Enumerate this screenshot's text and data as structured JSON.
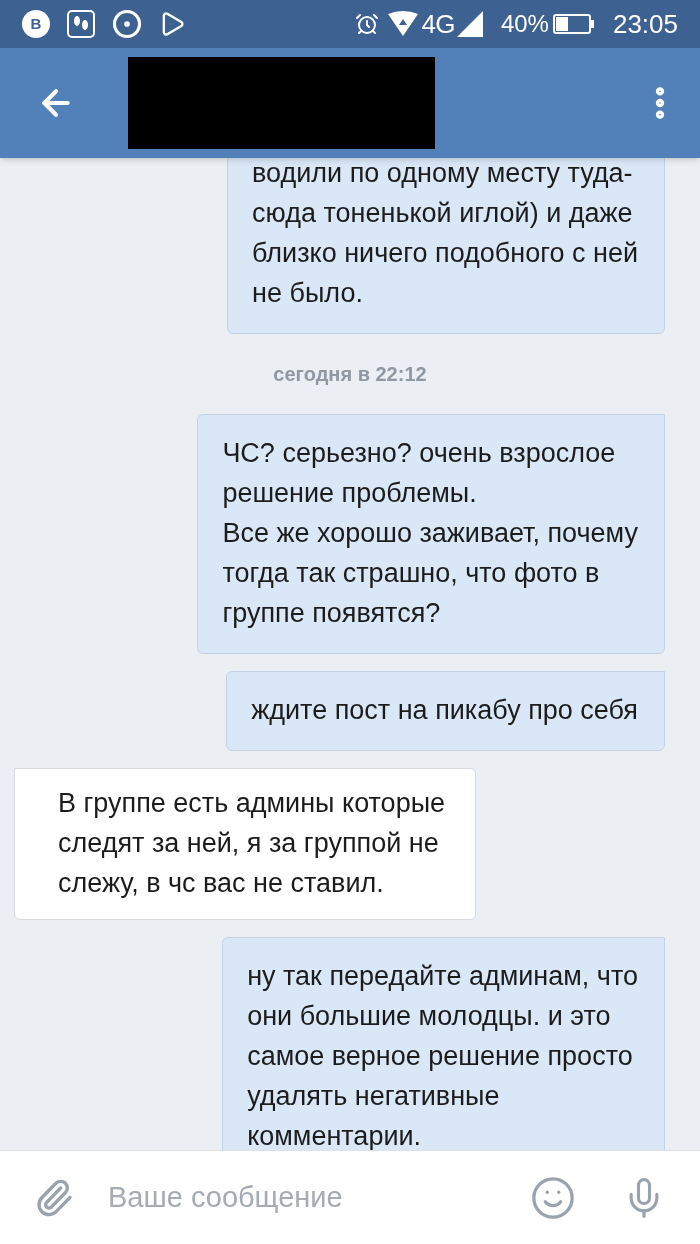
{
  "status_bar": {
    "app_badge": "В",
    "network": "4G",
    "battery": "40%",
    "time": "23:05"
  },
  "messages": [
    {
      "kind": "outgoing",
      "cut_top": true,
      "text": "водили по одному месту туда-\nсюда тоненькой иглой) и даже\nблизко ничего подобного с ней\nне было."
    },
    {
      "kind": "date",
      "text": "сегодня в 22:12"
    },
    {
      "kind": "outgoing",
      "cut_top": false,
      "text": "ЧС? серьезно? очень взрослое\nрешение проблемы.\nВсе же хорошо заживает, почему\nтогда так страшно, что фото в\nгруппе появятся?"
    },
    {
      "kind": "outgoing",
      "cut_top": false,
      "text": "ждите пост на пикабу про себя"
    },
    {
      "kind": "incoming",
      "cut_top": false,
      "text": "В группе есть админы которые\nследят за ней, я за группой не\nслежу, в чс вас не ставил."
    },
    {
      "kind": "outgoing",
      "cut_top": false,
      "text": "ну так передайте админам, что\nони большие молодцы. и это\nсамое верное решение просто\nудалять негативные\nкомментарии."
    }
  ],
  "composer": {
    "placeholder": "Ваше сообщение"
  }
}
